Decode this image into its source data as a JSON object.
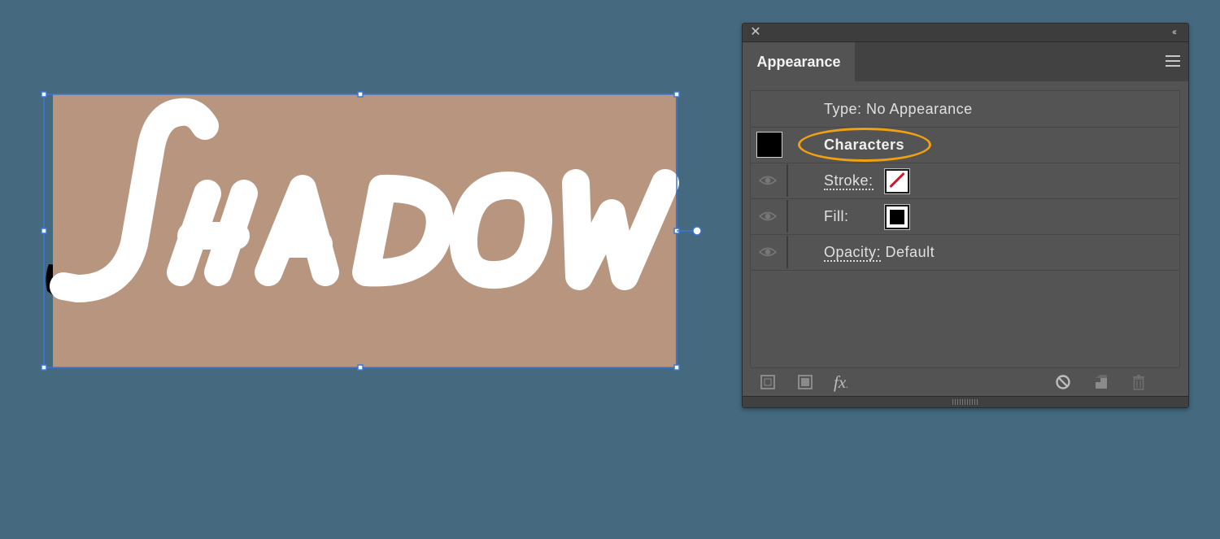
{
  "canvas": {
    "background_color": "#456a80",
    "artwork_text": "SHADOW",
    "artwork_fill": "#b8957f",
    "artwork_text_color": "#ffffff",
    "selection_color": "#3a78d8"
  },
  "panel": {
    "tab_label": "Appearance",
    "close_icon": "close-icon",
    "collapse_icon": "double-chevron-left-icon",
    "menu_icon": "hamburger-menu-icon",
    "rows": {
      "type": {
        "label": "Type: No Appearance"
      },
      "characters": {
        "label": "Characters",
        "swatch_color": "#000000",
        "highlight_color": "#f0a010"
      },
      "stroke": {
        "label": "Stroke:",
        "swatch": "none-red-slash"
      },
      "fill": {
        "label": "Fill:",
        "swatch_color": "#000000"
      },
      "opacity": {
        "label": "Opacity:",
        "value": "Default"
      }
    },
    "footer": {
      "add_stroke_icon": "add-new-stroke-icon",
      "add_fill_icon": "add-new-fill-icon",
      "fx_label": "fx",
      "clear_icon": "clear-appearance-icon",
      "duplicate_icon": "duplicate-item-icon",
      "delete_icon": "trash-icon"
    }
  }
}
